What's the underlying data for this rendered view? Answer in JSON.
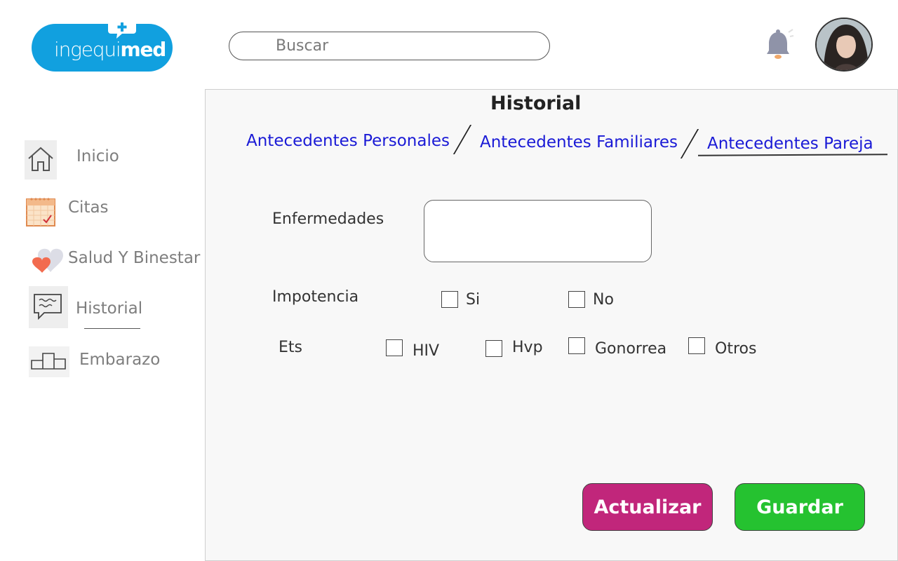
{
  "header": {
    "logo": {
      "text_light": "ingequi",
      "text_bold": "med",
      "brand_color": "#11a0df"
    },
    "search": {
      "placeholder": "Buscar"
    },
    "notification_icon": "bell-icon",
    "avatar": "user-avatar"
  },
  "sidebar": {
    "items": [
      {
        "label": "Inicio",
        "icon": "home-icon"
      },
      {
        "label": "Citas",
        "icon": "calendar-icon"
      },
      {
        "label": "Salud Y Binestar",
        "icon": "heart-icon"
      },
      {
        "label": "Historial",
        "icon": "chat-bubble-icon",
        "active": true
      },
      {
        "label": "Embarazo",
        "icon": "podium-icon"
      }
    ]
  },
  "main": {
    "title": "Historial",
    "tabs": [
      {
        "label": "Antecedentes Personales"
      },
      {
        "label": "Antecedentes Familiares"
      },
      {
        "label": "Antecedentes Pareja",
        "active": true
      }
    ],
    "form": {
      "enfermedades": {
        "label": "Enfermedades",
        "value": ""
      },
      "impotencia": {
        "label": "Impotencia",
        "options": [
          {
            "label": "Si",
            "checked": false
          },
          {
            "label": "No",
            "checked": false
          }
        ]
      },
      "ets": {
        "label": "Ets",
        "options": [
          {
            "label": "HIV",
            "checked": false
          },
          {
            "label": "Hvp",
            "checked": false
          },
          {
            "label": "Gonorrea",
            "checked": false
          },
          {
            "label": "Otros",
            "checked": false
          }
        ]
      }
    },
    "buttons": {
      "update_label": "Actualizar",
      "save_label": "Guardar",
      "update_color": "#c1267b",
      "save_color": "#25c230"
    }
  }
}
